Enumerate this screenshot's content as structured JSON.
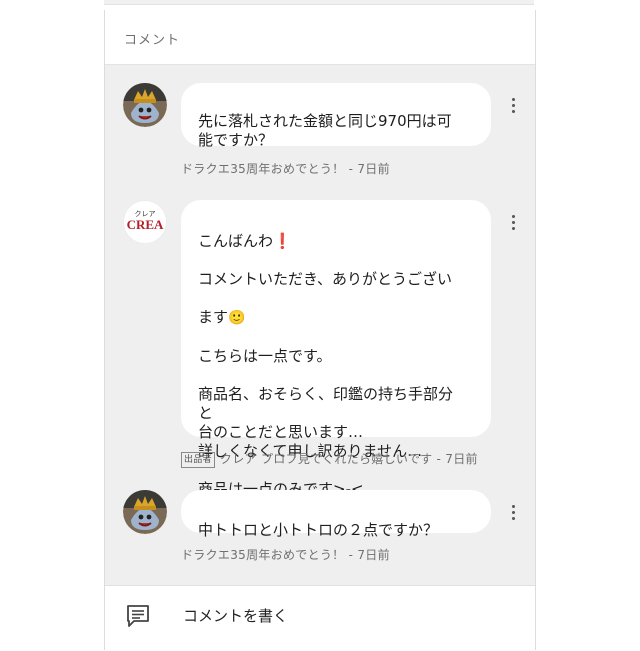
{
  "header": {
    "title": "コメント"
  },
  "comments": [
    {
      "author": "ドラクエ35周年おめでとう！",
      "avatar_icon": "king-slime-avatar-icon",
      "text": "先に落札された金額と同じ970円は可\n能ですか？",
      "time": "7日前",
      "is_seller": false
    },
    {
      "author": "クレア",
      "avatar_icon": "crea-logo-avatar",
      "avatar_logo_small": "クレア",
      "avatar_logo_big": "CREA",
      "seller_badge": "出品者",
      "bio": "プロフ見てくれたら嬉しいです",
      "text_line1": "こんばんわ",
      "text_line1_emoji": "❗",
      "text_line2": "コメントいただき、ありがとうござい",
      "text_line3": "ます",
      "text_line3_emoji": "🙂",
      "text_rest": "こちらは一点です。\n\n商品名、おそらく、印鑑の持ち手部分\nと\n台のことだと思います…\n詳しくなくて申し訳ありません…\n\n商品は一点のみです>-<",
      "time": "7日前",
      "is_seller": true
    },
    {
      "author": "ドラクエ35周年おめでとう！",
      "avatar_icon": "king-slime-avatar-icon",
      "text": "中トトロと小トトロの２点ですか？",
      "time": "7日前",
      "is_seller": false
    }
  ],
  "meta_separator": " - ",
  "write_bar": {
    "label": "コメントを書く",
    "icon": "comment-write-icon"
  },
  "colors": {
    "panel_bg": "#efefef",
    "bubble_bg": "#ffffff",
    "meta_text": "#6f6f6f",
    "crea_red": "#b3202a"
  }
}
